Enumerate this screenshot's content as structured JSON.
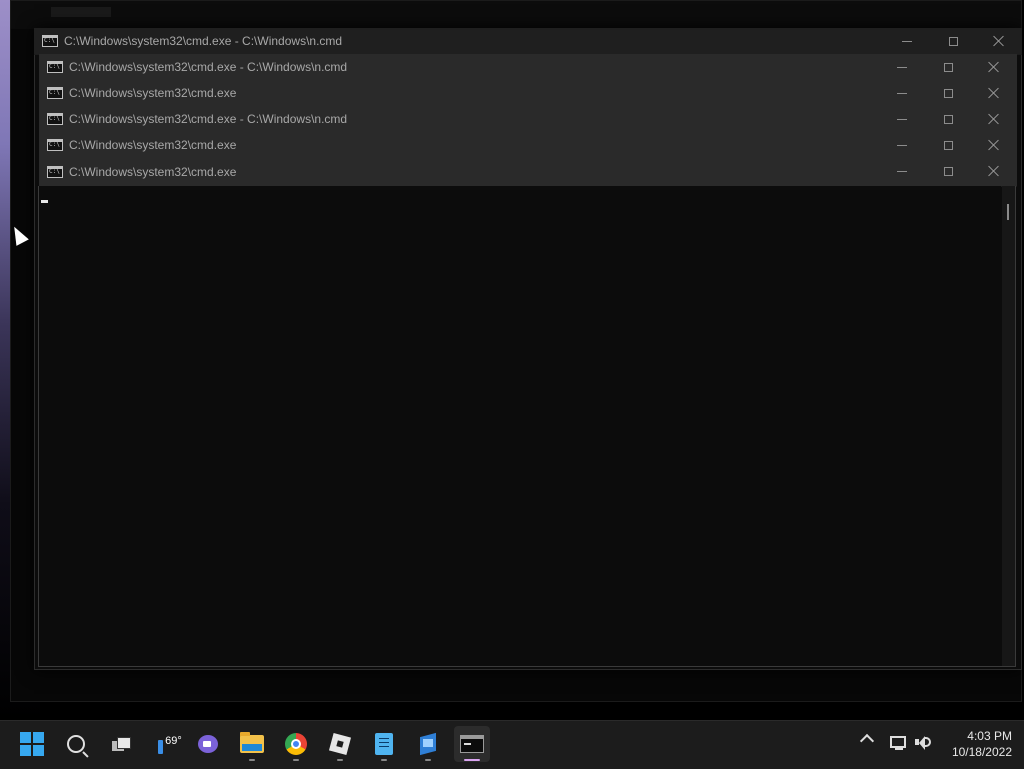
{
  "windows": [
    {
      "title": "C:\\Windows\\system32\\cmd.exe - C:\\Windows\\n.cmd"
    },
    {
      "title": "C:\\Windows\\system32\\cmd.exe - C:\\Windows\\n.cmd"
    },
    {
      "title": "C:\\Windows\\system32\\cmd.exe"
    },
    {
      "title": "C:\\Windows\\system32\\cmd.exe - C:\\Windows\\n.cmd"
    },
    {
      "title": "C:\\Windows\\system32\\cmd.exe"
    },
    {
      "title": "C:\\Windows\\system32\\cmd.exe"
    }
  ],
  "taskbar": {
    "weather_temp": "69°",
    "pinned": [
      "start-icon",
      "search-icon",
      "task-view-icon",
      "widgets-icon",
      "teams-chat-icon",
      "file-explorer-icon",
      "chrome-icon",
      "roblox-icon",
      "notepad-icon",
      "app-icon",
      "terminal-icon"
    ],
    "active_app": "terminal-icon"
  },
  "clock": {
    "time": "4:03 PM",
    "date": "10/18/2022"
  },
  "colors": {
    "console_bg": "#0c0c0c",
    "taskbar_bg": "#1c1c1c",
    "start_blue": "#36a8f0",
    "active_indicator": "#d9a4f0"
  }
}
